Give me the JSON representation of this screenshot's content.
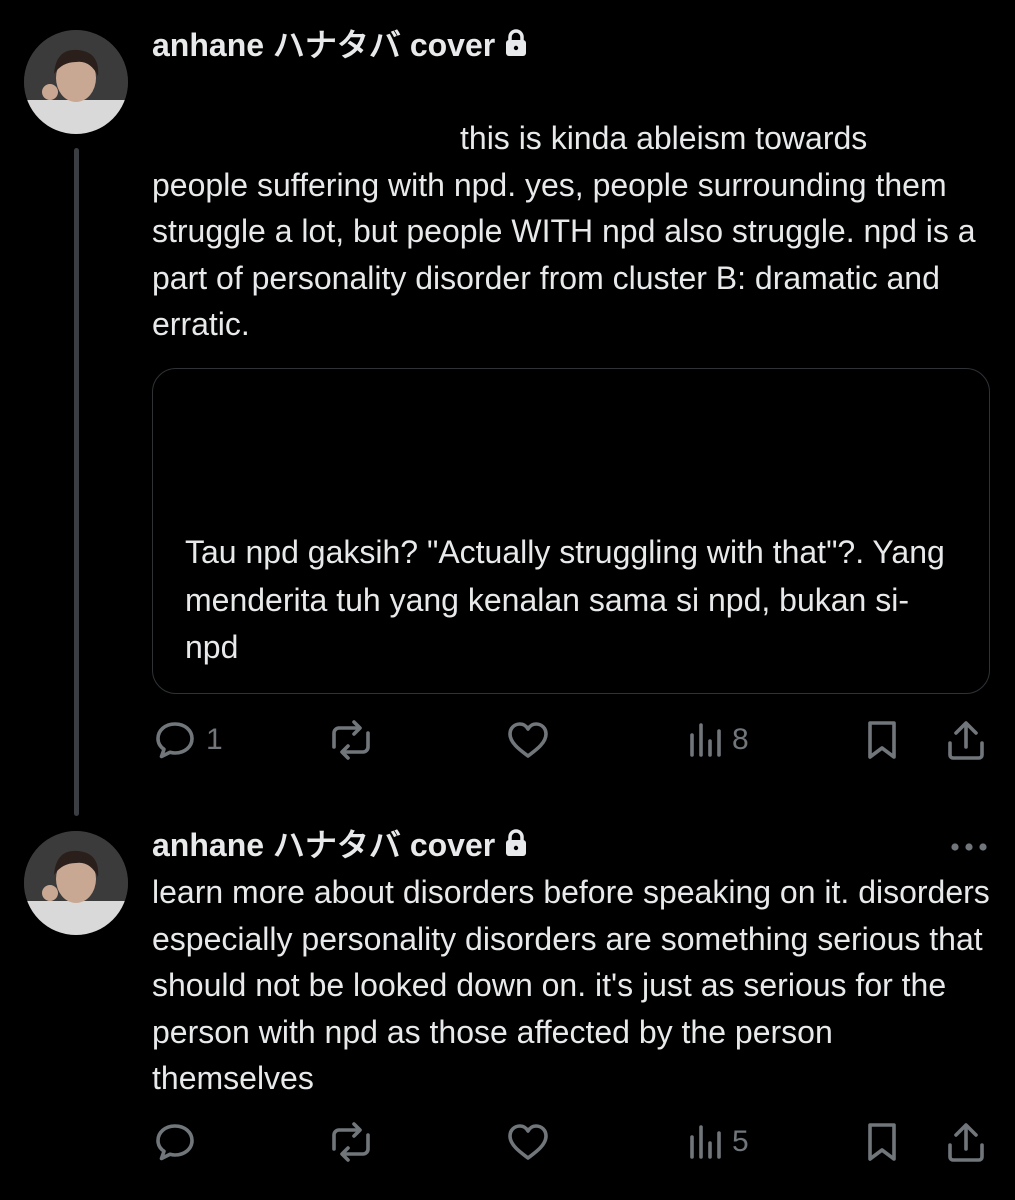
{
  "posts": [
    {
      "author": "anhane ハナタバ cover",
      "locked": true,
      "text": {
        "line1": "this is kinda ableism towards",
        "rest": "people suffering with npd. yes, people surrounding them struggle a lot, but people WITH npd also struggle. npd is a part of personality disorder from cluster B: dramatic and erratic."
      },
      "quote": {
        "text": "Tau npd gaksih? \"Actually struggling with that\"?. Yang menderita tuh yang kenalan sama si npd, bukan si-npd"
      },
      "actions": {
        "replies": "1",
        "views": "8"
      }
    },
    {
      "author": "anhane ハナタバ cover",
      "locked": true,
      "text": "learn more about disorders before speaking on it. disorders especially personality disorders are something serious that should not be looked down on. it's just as serious for the person with npd as those affected by the person themselves",
      "actions": {
        "views": "5"
      }
    }
  ],
  "colors": {
    "background": "#000000",
    "text": "#e7e9ea",
    "muted": "#71767b",
    "border": "#2f3336"
  },
  "icons": [
    "avatar",
    "lock-icon",
    "reply-icon",
    "repost-icon",
    "like-icon",
    "views-icon",
    "bookmark-icon",
    "share-icon",
    "more-icon"
  ]
}
